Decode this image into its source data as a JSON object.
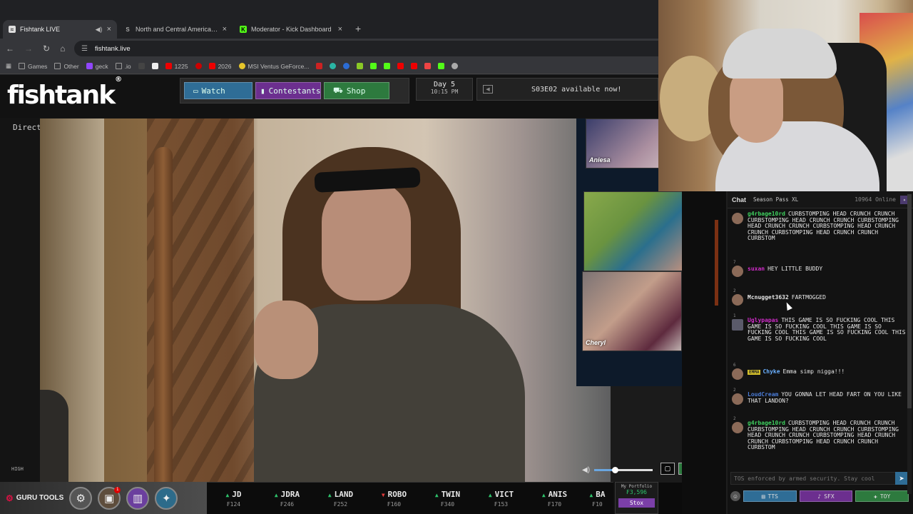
{
  "browser": {
    "tabs": [
      {
        "title": "Fishtank LIVE",
        "active": true,
        "icon": "fishtank-favicon",
        "audio": true
      },
      {
        "title": "North and Central America: Co",
        "active": false,
        "icon": "site-favicon"
      },
      {
        "title": "Moderator - Kick Dashboard",
        "active": false,
        "icon": "kick-favicon"
      }
    ],
    "address": "fishtank.live",
    "bookmarks": [
      {
        "label": "Games",
        "type": "folder"
      },
      {
        "label": "Other",
        "type": "folder"
      },
      {
        "label": "geck",
        "type": "twitch"
      },
      {
        "label": ".io",
        "type": "folder"
      },
      {
        "label": "",
        "type": "icon"
      },
      {
        "label": "",
        "type": "icon"
      },
      {
        "label": "1225",
        "type": "youtube"
      },
      {
        "label": "",
        "type": "icon"
      },
      {
        "label": "2026",
        "type": "youtube"
      },
      {
        "label": "MSI Ventus GeForce...",
        "type": "msi"
      }
    ]
  },
  "site": {
    "logo": "fishtank",
    "logo_mark": "®",
    "nav": {
      "watch": "Watch",
      "contestants": "Contestants",
      "shop": "Shop"
    },
    "day": "Day 5",
    "time": "10:15 PM",
    "ticker": "S03E02 available now!",
    "director_mode": "Director Mode",
    "quality": "HIGH",
    "volume_level": 0.35,
    "camera_labels": [
      "Aniesa",
      "",
      "Cheryl"
    ]
  },
  "tools": {
    "label": "GURU TOOLS",
    "badge": "1"
  },
  "stocks": [
    {
      "name": "JD",
      "dir": "up",
      "price": "₣124"
    },
    {
      "name": "JDRA",
      "dir": "up",
      "price": "₣246"
    },
    {
      "name": "LAND",
      "dir": "up",
      "price": "₣252"
    },
    {
      "name": "ROBO",
      "dir": "down",
      "price": "₣160"
    },
    {
      "name": "TWIN",
      "dir": "up",
      "price": "₣340"
    },
    {
      "name": "VICT",
      "dir": "up",
      "price": "₣153"
    },
    {
      "name": "ANIS",
      "dir": "up",
      "price": "₣170"
    },
    {
      "name": "BA",
      "dir": "up",
      "price": "₣10"
    }
  ],
  "portfolio": {
    "label": "My Portfolio",
    "value": "₣3,596",
    "button": "Stox"
  },
  "chat": {
    "tab": "Chat",
    "tab2": "Season Pass XL",
    "online": "10964 Online",
    "messages": [
      {
        "user": "g4rbage10rd",
        "user_color": "#3fcf5f",
        "text": "CURBSTOMPING HEAD CRUNCH CRUNCH CURBSTOMPING HEAD CRUNCH CRUNCH CURBSTOMPING HEAD CRUNCH CRUNCH CURBSTOMPING HEAD CRUNCH CRUNCH CURBSTOMPING HEAD CRUNCH CRUNCH CURBSTOM",
        "level": ""
      },
      {
        "user": "suxan",
        "user_color": "#d02cc9",
        "text": "HEY LITTLE BUDDY",
        "level": "7"
      },
      {
        "user": "Mcnugget3632",
        "user_color": "#e6e6e6",
        "text": "FARTMOGGED",
        "level": "2"
      },
      {
        "user": "Uglypapas",
        "user_color": "#d02cc9",
        "text": "THIS GAME IS SO FUCKING COOL THIS GAME IS SO FUCKING COOL THIS GAME IS SO FUCKING COOL THIS GAME IS SO FUCKING COOL THIS GAME IS SO FUCKING COOL",
        "level": "1"
      },
      {
        "user": "Chyke",
        "user_color": "#6ab0ff",
        "badge": "EMMA",
        "text": "Emma simp nigga!!!",
        "level": "6"
      },
      {
        "user": "LoudCream",
        "user_color": "#4a7bd6",
        "text": "YOU GONNA LET HEAD FART ON YOU LIKE THAT LANDON?",
        "level": "2"
      },
      {
        "user": "g4rbage10rd",
        "user_color": "#3fcf5f",
        "text": "CURBSTOMPING HEAD CRUNCH CRUNCH CURBSTOMPING HEAD CRUNCH CRUNCH CURBSTOMPING HEAD CRUNCH CRUNCH CURBSTOMPING HEAD CRUNCH CRUNCH CURBSTOMPING HEAD CRUNCH CRUNCH CURBSTOM",
        "level": "2"
      }
    ],
    "input_placeholder": "TOS enforced by armed security. Stay cool",
    "buttons": {
      "tts": "TTS",
      "sfx": "SFX",
      "toy": "TOY"
    }
  }
}
